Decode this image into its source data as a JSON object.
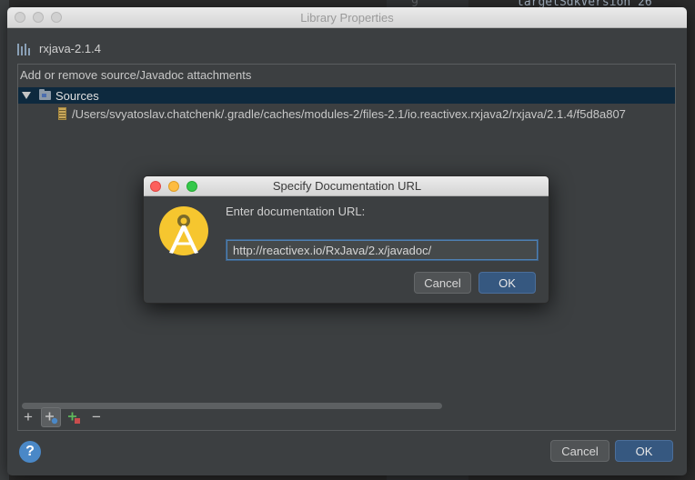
{
  "background": {
    "line_numbers": [
      "9"
    ],
    "code_top": "targetSdkVersion 26"
  },
  "library_dialog": {
    "title": "Library Properties",
    "library_name": "rxjava-2.1.4",
    "panel_title": "Add or remove source/Javadoc attachments",
    "tree": {
      "root_label": "Sources",
      "child_path": "/Users/svyatoslav.chatchenk/.gradle/caches/modules-2/files-2.1/io.reactivex.rxjava2/rxjava/2.1.4/f5d8a807"
    },
    "toolbar": {
      "add": "+",
      "remove": "−"
    },
    "help_label": "?",
    "cancel_label": "Cancel",
    "ok_label": "OK"
  },
  "url_dialog": {
    "title": "Specify Documentation URL",
    "prompt": "Enter documentation URL:",
    "url_value": "http://reactivex.io/RxJava/2.x/javadoc/",
    "cancel_label": "Cancel",
    "ok_label": "OK"
  },
  "colors": {
    "accent": "#4b6eaf",
    "ok_button": "#365880",
    "selection": "#0d293e",
    "traffic_red": "#fc605c",
    "traffic_yellow": "#fdbc40",
    "traffic_green": "#34c84a",
    "logo_yellow": "#f6c62f"
  }
}
